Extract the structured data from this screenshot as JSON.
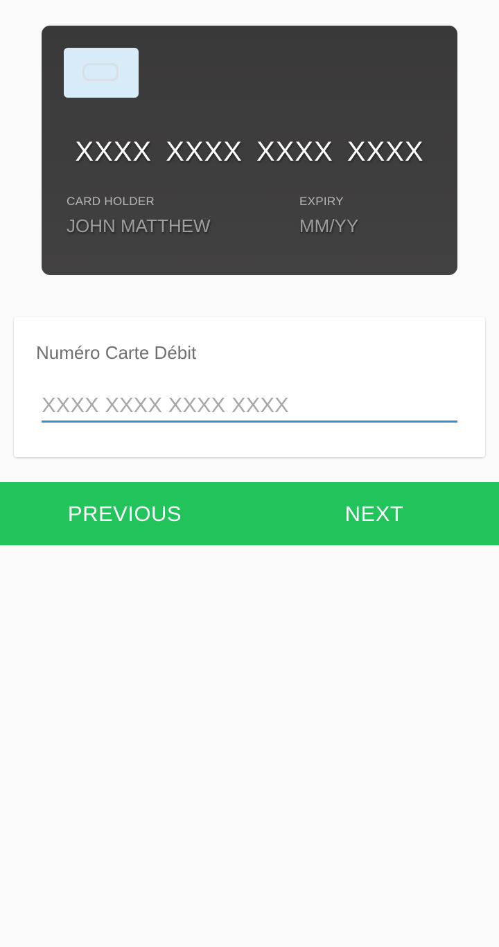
{
  "card_preview": {
    "number": "XXXX XXXX XXXX XXXX",
    "holder_label": "CARD HOLDER",
    "holder_value": "JOHN MATTHEW",
    "expiry_label": "EXPIRY",
    "expiry_value": "MM/YY",
    "colors": {
      "card_background": "#3a3939",
      "chip": "#d7ebf9"
    }
  },
  "form": {
    "label": "Numéro Carte Débit",
    "input_value": "",
    "input_placeholder": "XXXX XXXX XXXX XXXX",
    "accent_color": "#3a8fd0"
  },
  "navigation": {
    "previous_label": "PREVIOUS",
    "next_label": "NEXT",
    "background_color": "#21c35a"
  }
}
